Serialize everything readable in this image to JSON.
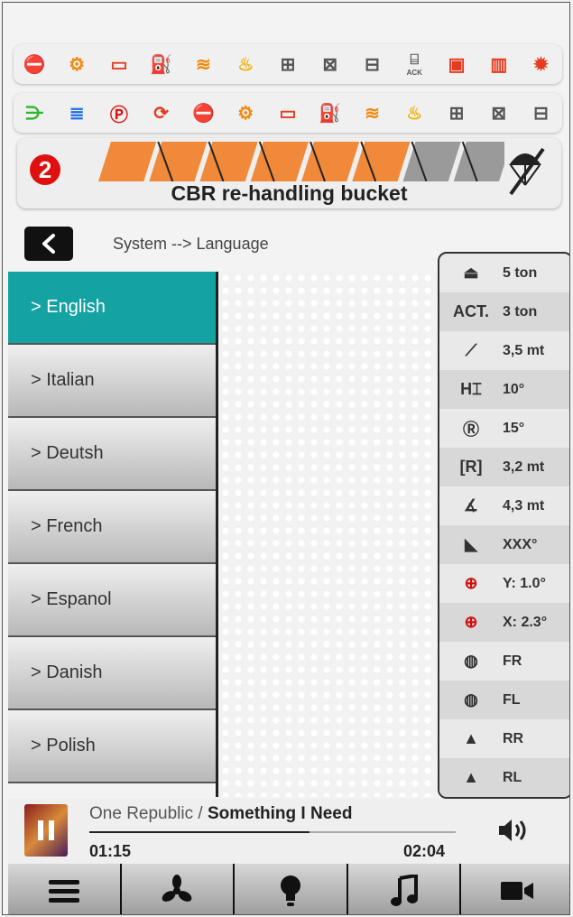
{
  "warning_icons": {
    "row1": [
      {
        "name": "brake-stop-icon",
        "glyph": "⛔",
        "color": "#e53b20"
      },
      {
        "name": "engine-warning-icon",
        "glyph": "⚙",
        "color": "#f08a10"
      },
      {
        "name": "battery-icon",
        "glyph": "▭",
        "color": "#e53b20"
      },
      {
        "name": "oil-pressure-icon",
        "glyph": "⛽",
        "color": "#e53b20"
      },
      {
        "name": "hydraulic-icon",
        "glyph": "≋",
        "color": "#f08a10"
      },
      {
        "name": "coolant-temp-icon",
        "glyph": "♨",
        "color": "#f0b000"
      },
      {
        "name": "air-filter-icon",
        "glyph": "⊞",
        "color": "#555555"
      },
      {
        "name": "air-filter-blocked-icon",
        "glyph": "⊠",
        "color": "#555555"
      },
      {
        "name": "fuel-filter-icon",
        "glyph": "⊟",
        "color": "#555555"
      },
      {
        "name": "ack-icon",
        "glyph": "⌸",
        "color": "#555555"
      },
      {
        "name": "hydraulic-oil-level-icon",
        "glyph": "▣",
        "color": "#e53b20"
      },
      {
        "name": "hydraulic-oil-temp-icon",
        "glyph": "▥",
        "color": "#e53b20"
      },
      {
        "name": "gear-warning-icon",
        "glyph": "✹",
        "color": "#e53b20"
      }
    ],
    "row2": [
      {
        "name": "fog-light-icon",
        "glyph": "⋺",
        "color": "#2bb82b"
      },
      {
        "name": "high-beam-icon",
        "glyph": "≣",
        "color": "#2070e0"
      },
      {
        "name": "parking-brake-icon",
        "glyph": "Ⓟ",
        "color": "#e01010"
      },
      {
        "name": "transmission-icon",
        "glyph": "⟳",
        "color": "#e53b20"
      },
      {
        "name": "brake-stop-icon-2",
        "glyph": "⛔",
        "color": "#e53b20"
      },
      {
        "name": "engine-warning-icon-2",
        "glyph": "⚙",
        "color": "#f08a10"
      },
      {
        "name": "battery-icon-2",
        "glyph": "▭",
        "color": "#e53b20"
      },
      {
        "name": "oil-pressure-icon-2",
        "glyph": "⛽",
        "color": "#e53b20"
      },
      {
        "name": "hydraulic-icon-2",
        "glyph": "≋",
        "color": "#f08a10"
      },
      {
        "name": "coolant-temp-icon-2",
        "glyph": "♨",
        "color": "#f0b000"
      },
      {
        "name": "air-filter-icon-2",
        "glyph": "⊞",
        "color": "#555555"
      },
      {
        "name": "air-filter-blocked-icon-2",
        "glyph": "⊠",
        "color": "#555555"
      },
      {
        "name": "fuel-filter-icon-2",
        "glyph": "⊟",
        "color": "#555555"
      }
    ],
    "ack_label": "ACK"
  },
  "bucket": {
    "badge": "2",
    "title": "CBR re-handling bucket",
    "bar_color": "#f08a3a",
    "bar_fill_segments": 6,
    "bar_total_segments": 8
  },
  "nav": {
    "breadcrumb": "System --> Language"
  },
  "languages": [
    {
      "label": "> English",
      "selected": true
    },
    {
      "label": "> Italian",
      "selected": false
    },
    {
      "label": "> Deutsh",
      "selected": false
    },
    {
      "label": "> French",
      "selected": false
    },
    {
      "label": "> Espanol",
      "selected": false
    },
    {
      "label": "> Danish",
      "selected": false
    },
    {
      "label": "> Polish",
      "selected": false
    }
  ],
  "accent_color": "#14a2a3",
  "status": [
    {
      "icon": "weight-icon",
      "glyph": "⏏",
      "value": "5 ton"
    },
    {
      "icon": "act-label",
      "glyph": "ACT.",
      "value": "3 ton"
    },
    {
      "icon": "boom-length-icon",
      "glyph": "⟋",
      "value": "3,5 mt"
    },
    {
      "icon": "height-icon",
      "glyph": "H⌶",
      "value": "10°"
    },
    {
      "icon": "rotation-icon",
      "glyph": "Ⓡ",
      "value": "15°"
    },
    {
      "icon": "radius-icon",
      "glyph": "[R]",
      "value": "3,2 mt"
    },
    {
      "icon": "angle-icon",
      "glyph": "∡",
      "value": "4,3 mt"
    },
    {
      "icon": "bucket-angle-icon",
      "glyph": "◣",
      "value": "XXX°"
    },
    {
      "icon": "inclination-y-icon",
      "glyph": "⊕",
      "value": "Y: 1.0°"
    },
    {
      "icon": "inclination-x-icon",
      "glyph": "⊕",
      "value": "X: 2.3°"
    },
    {
      "icon": "tire-fr-icon",
      "glyph": "◍",
      "value": "FR"
    },
    {
      "icon": "tire-fl-icon",
      "glyph": "◍",
      "value": "FL"
    },
    {
      "icon": "terrain-rr-icon",
      "glyph": "▲",
      "value": "RR"
    },
    {
      "icon": "terrain-rl-icon",
      "glyph": "▲",
      "value": "RL"
    }
  ],
  "player": {
    "artist": "One Republic / ",
    "track": "Something I Need",
    "elapsed": "01:15",
    "total": "02:04",
    "progress": 0.6
  },
  "bottom_nav": [
    {
      "name": "menu-icon"
    },
    {
      "name": "fan-icon"
    },
    {
      "name": "light-bulb-icon"
    },
    {
      "name": "music-note-icon"
    },
    {
      "name": "camera-icon"
    }
  ]
}
